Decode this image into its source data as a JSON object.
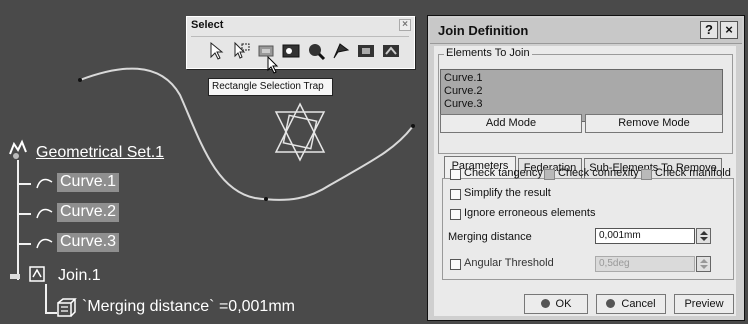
{
  "tree": {
    "root": "Geometrical Set.1",
    "items": [
      "Curve.1",
      "Curve.2",
      "Curve.3"
    ],
    "join": "Join.1",
    "parameter": "`Merging distance` =0,001mm"
  },
  "select_toolbar": {
    "title": "Select",
    "close": "×",
    "tooltip": "Rectangle Selection Trap",
    "icons": [
      "select-arrow-icon",
      "selection-trap-icon",
      "rectangle-selection-trap-icon",
      "intersecting-trap-icon",
      "polygon-trap-icon",
      "free-hand-trap-icon",
      "outside-rectangle-trap-icon",
      "intersecting-outside-trap-icon"
    ]
  },
  "dialog": {
    "title": "Join Definition",
    "help_btn": "?",
    "close_btn": "×",
    "elements_group": "Elements To Join",
    "elements": [
      "Curve.1",
      "Curve.2",
      "Curve.3"
    ],
    "add_mode": "Add Mode",
    "remove_mode": "Remove Mode",
    "tabs": [
      "Parameters",
      "Federation",
      "Sub-Elements To Remove"
    ],
    "check_tangency": "Check tangency",
    "check_connexity": "Check connexity",
    "check_manifold": "Check manifold",
    "simplify": "Simplify the result",
    "ignore": "Ignore erroneous elements",
    "merging_label": "Merging distance",
    "merging_value": "0,001mm",
    "angular_label": "Angular Threshold",
    "angular_value": "0,5deg",
    "ok": "OK",
    "cancel": "Cancel",
    "preview": "Preview"
  },
  "colors": {
    "viewport_bg": "#4a4a4a",
    "highlight": "#8f8f8f",
    "dialog_bg": "#eaeaea"
  }
}
